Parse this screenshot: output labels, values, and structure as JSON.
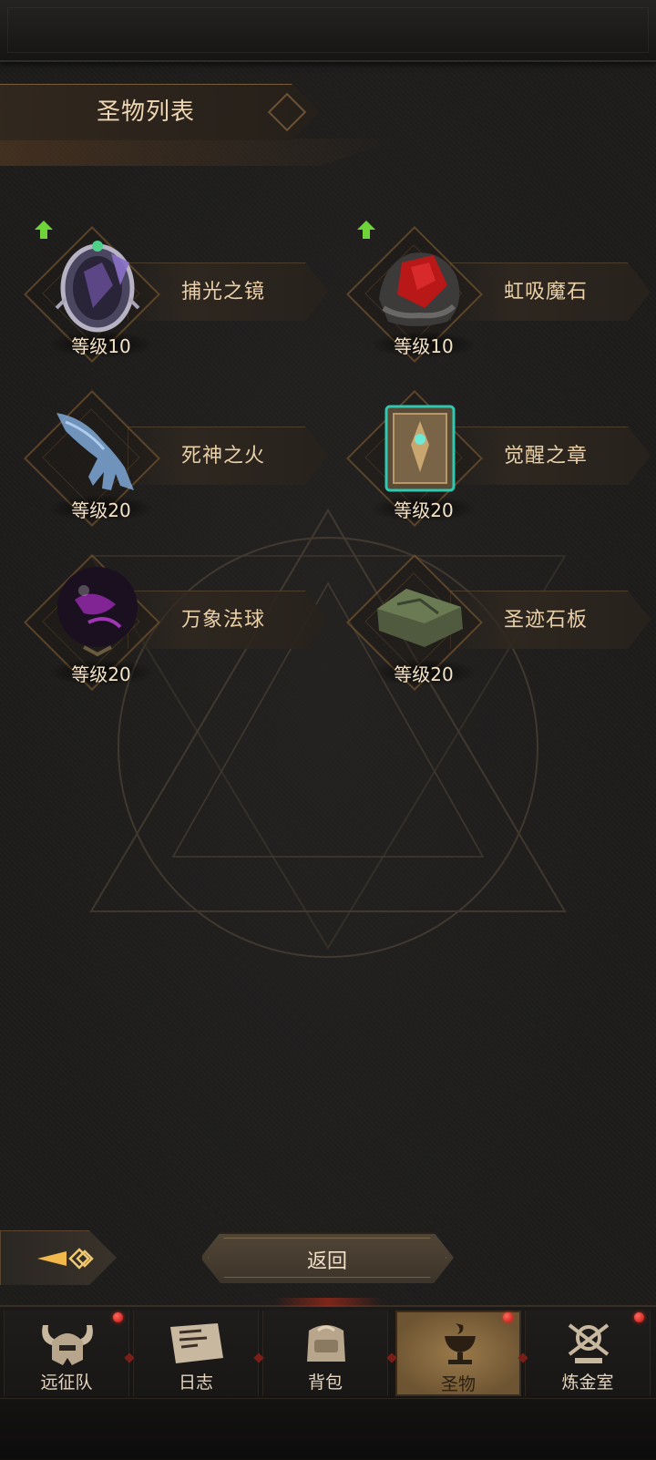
{
  "header": {
    "title": "圣物列表"
  },
  "relics": [
    {
      "name": "捕光之镜",
      "level": "等级10",
      "icon": "mirror-icon",
      "upgradable": true
    },
    {
      "name": "虹吸魔石",
      "level": "等级10",
      "icon": "red-stone-icon",
      "upgradable": true
    },
    {
      "name": "死神之火",
      "level": "等级20",
      "icon": "ghost-hand-icon",
      "upgradable": false
    },
    {
      "name": "觉醒之章",
      "level": "等级20",
      "icon": "tome-icon",
      "upgradable": false
    },
    {
      "name": "万象法球",
      "level": "等级20",
      "icon": "orb-icon",
      "upgradable": false
    },
    {
      "name": "圣迹石板",
      "level": "等级20",
      "icon": "stone-tablet-icon",
      "upgradable": false
    }
  ],
  "actions": {
    "back_label": "返回",
    "side_arrow_icon": "diamond-arrow-icon"
  },
  "nav": {
    "tabs": [
      {
        "label": "远征队",
        "icon": "horned-helmet-icon",
        "badge": true,
        "active": false
      },
      {
        "label": "日志",
        "icon": "scroll-icon",
        "badge": false,
        "active": false
      },
      {
        "label": "背包",
        "icon": "backpack-icon",
        "badge": false,
        "active": false
      },
      {
        "label": "圣物",
        "icon": "chalice-icon",
        "badge": true,
        "active": true
      },
      {
        "label": "炼金室",
        "icon": "alchemy-icon",
        "badge": true,
        "active": false
      }
    ]
  },
  "colors": {
    "background": "#1c1b1a",
    "text_gold": "#ead0a8",
    "active_tab": "#8a6a3e",
    "badge_red": "#d01818",
    "upgrade_green": "#6fd43a"
  }
}
